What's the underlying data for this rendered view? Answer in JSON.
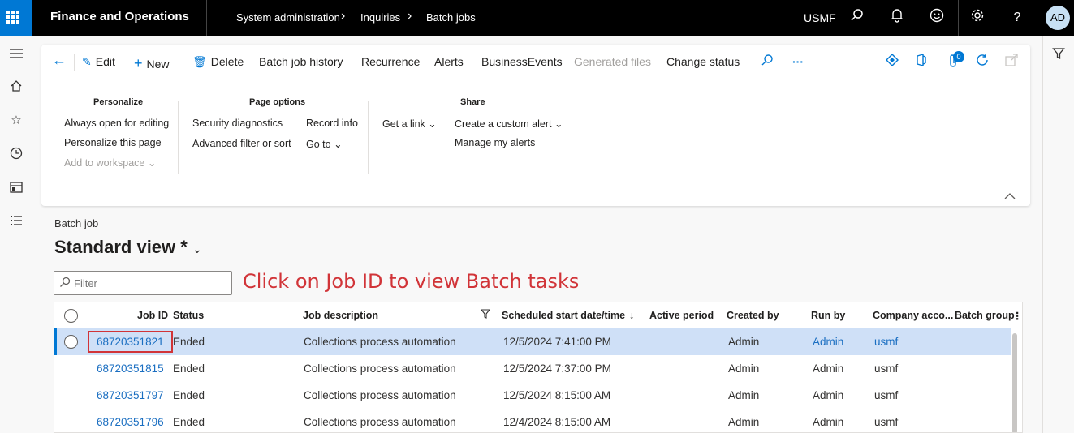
{
  "app": {
    "title": "Finance and Operations",
    "company": "USMF",
    "avatar_initials": "AD"
  },
  "breadcrumb": [
    "System administration",
    "Inquiries",
    "Batch jobs"
  ],
  "actions": {
    "edit": "Edit",
    "new": "New",
    "delete": "Delete",
    "history": "Batch job history",
    "recurrence": "Recurrence",
    "alerts": "Alerts",
    "business_events": "BusinessEvents",
    "generated_files": "Generated files",
    "change_status": "Change status",
    "attachments_count": "0"
  },
  "menu": {
    "personalize": {
      "title": "Personalize",
      "items": [
        "Always open for editing",
        "Personalize this page",
        "Add to workspace"
      ]
    },
    "page_options": {
      "title": "Page options",
      "col1": [
        "Security diagnostics",
        "Advanced filter or sort"
      ],
      "col2": [
        "Record info",
        "Go to"
      ]
    },
    "share": {
      "title": "Share",
      "col1": [
        "Get a link"
      ],
      "col2": [
        "Create a custom alert",
        "Manage my alerts"
      ]
    }
  },
  "page": {
    "entity": "Batch job",
    "view_name": "Standard view *",
    "filter_placeholder": "Filter"
  },
  "annotation": "Click on Job ID to view Batch tasks",
  "grid": {
    "columns": [
      "Job ID",
      "Status",
      "Job description",
      "Scheduled start date/time",
      "Active period",
      "Created by",
      "Run by",
      "Company acco...",
      "Batch group"
    ],
    "rows": [
      {
        "job_id": "68720351821",
        "status": "Ended",
        "description": "Collections process automation",
        "scheduled": "12/5/2024 7:41:00 PM",
        "created_by": "Admin",
        "run_by": "Admin",
        "company": "usmf"
      },
      {
        "job_id": "68720351815",
        "status": "Ended",
        "description": "Collections process automation",
        "scheduled": "12/5/2024 7:37:00 PM",
        "created_by": "Admin",
        "run_by": "Admin",
        "company": "usmf"
      },
      {
        "job_id": "68720351797",
        "status": "Ended",
        "description": "Collections process automation",
        "scheduled": "12/5/2024 8:15:00 AM",
        "created_by": "Admin",
        "run_by": "Admin",
        "company": "usmf"
      },
      {
        "job_id": "68720351796",
        "status": "Ended",
        "description": "Collections process automation",
        "scheduled": "12/4/2024 8:15:00 AM",
        "created_by": "Admin",
        "run_by": "Admin",
        "company": "usmf"
      }
    ]
  },
  "colors": {
    "accent": "#0078d4",
    "annotation": "#d13438",
    "selected_row": "#cfe0f7"
  }
}
